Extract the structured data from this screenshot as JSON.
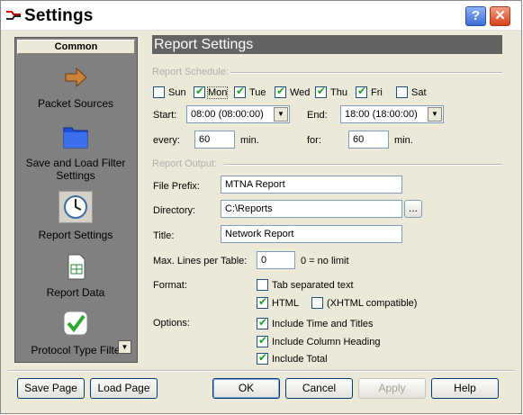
{
  "window": {
    "title": "Settings"
  },
  "sidebar": {
    "header": "Common",
    "items": [
      {
        "label": "Packet Sources",
        "icon": "arrow-icon"
      },
      {
        "label": "Save and Load Filter Settings",
        "icon": "folder-icon"
      },
      {
        "label": "Report Settings",
        "icon": "clock-icon"
      },
      {
        "label": "Report Data",
        "icon": "document-icon"
      },
      {
        "label": "Protocol Type Filte",
        "icon": "checkmark-icon"
      }
    ]
  },
  "main": {
    "title": "Report Settings",
    "schedule": {
      "group_label": "Report Schedule:",
      "days": [
        {
          "label": "Sun",
          "checked": false
        },
        {
          "label": "Mon",
          "checked": true
        },
        {
          "label": "Tue",
          "checked": true
        },
        {
          "label": "Wed",
          "checked": true
        },
        {
          "label": "Thu",
          "checked": true
        },
        {
          "label": "Fri",
          "checked": true
        },
        {
          "label": "Sat",
          "checked": false
        }
      ],
      "start_label": "Start:",
      "start_value": "08:00 (08:00:00)",
      "end_label": "End:",
      "end_value": "18:00 (18:00:00)",
      "every_label": "every:",
      "every_value": "60",
      "every_unit": "min.",
      "for_label": "for:",
      "for_value": "60",
      "for_unit": "min."
    },
    "output": {
      "group_label": "Report Output:",
      "prefix_label": "File Prefix:",
      "prefix_value": "MTNA Report",
      "dir_label": "Directory:",
      "dir_value": "C:\\Reports",
      "browse_label": "...",
      "title_label": "Title:",
      "title_value": "Network Report",
      "maxlines_label": "Max. Lines per Table:",
      "maxlines_value": "0",
      "maxlines_hint": "0 = no limit",
      "format_label": "Format:",
      "format_tab": "Tab separated text",
      "format_html": "HTML",
      "format_xhtml": "(XHTML compatible)",
      "options_label": "Options:",
      "opt_time": "Include Time and Titles",
      "opt_column": "Include Column Heading",
      "opt_total": "Include Total"
    }
  },
  "footer": {
    "save_page": "Save Page",
    "load_page": "Load Page",
    "ok": "OK",
    "cancel": "Cancel",
    "apply": "Apply",
    "help": "Help"
  },
  "titlebar_buttons": {
    "help": "?",
    "close": "✕"
  }
}
